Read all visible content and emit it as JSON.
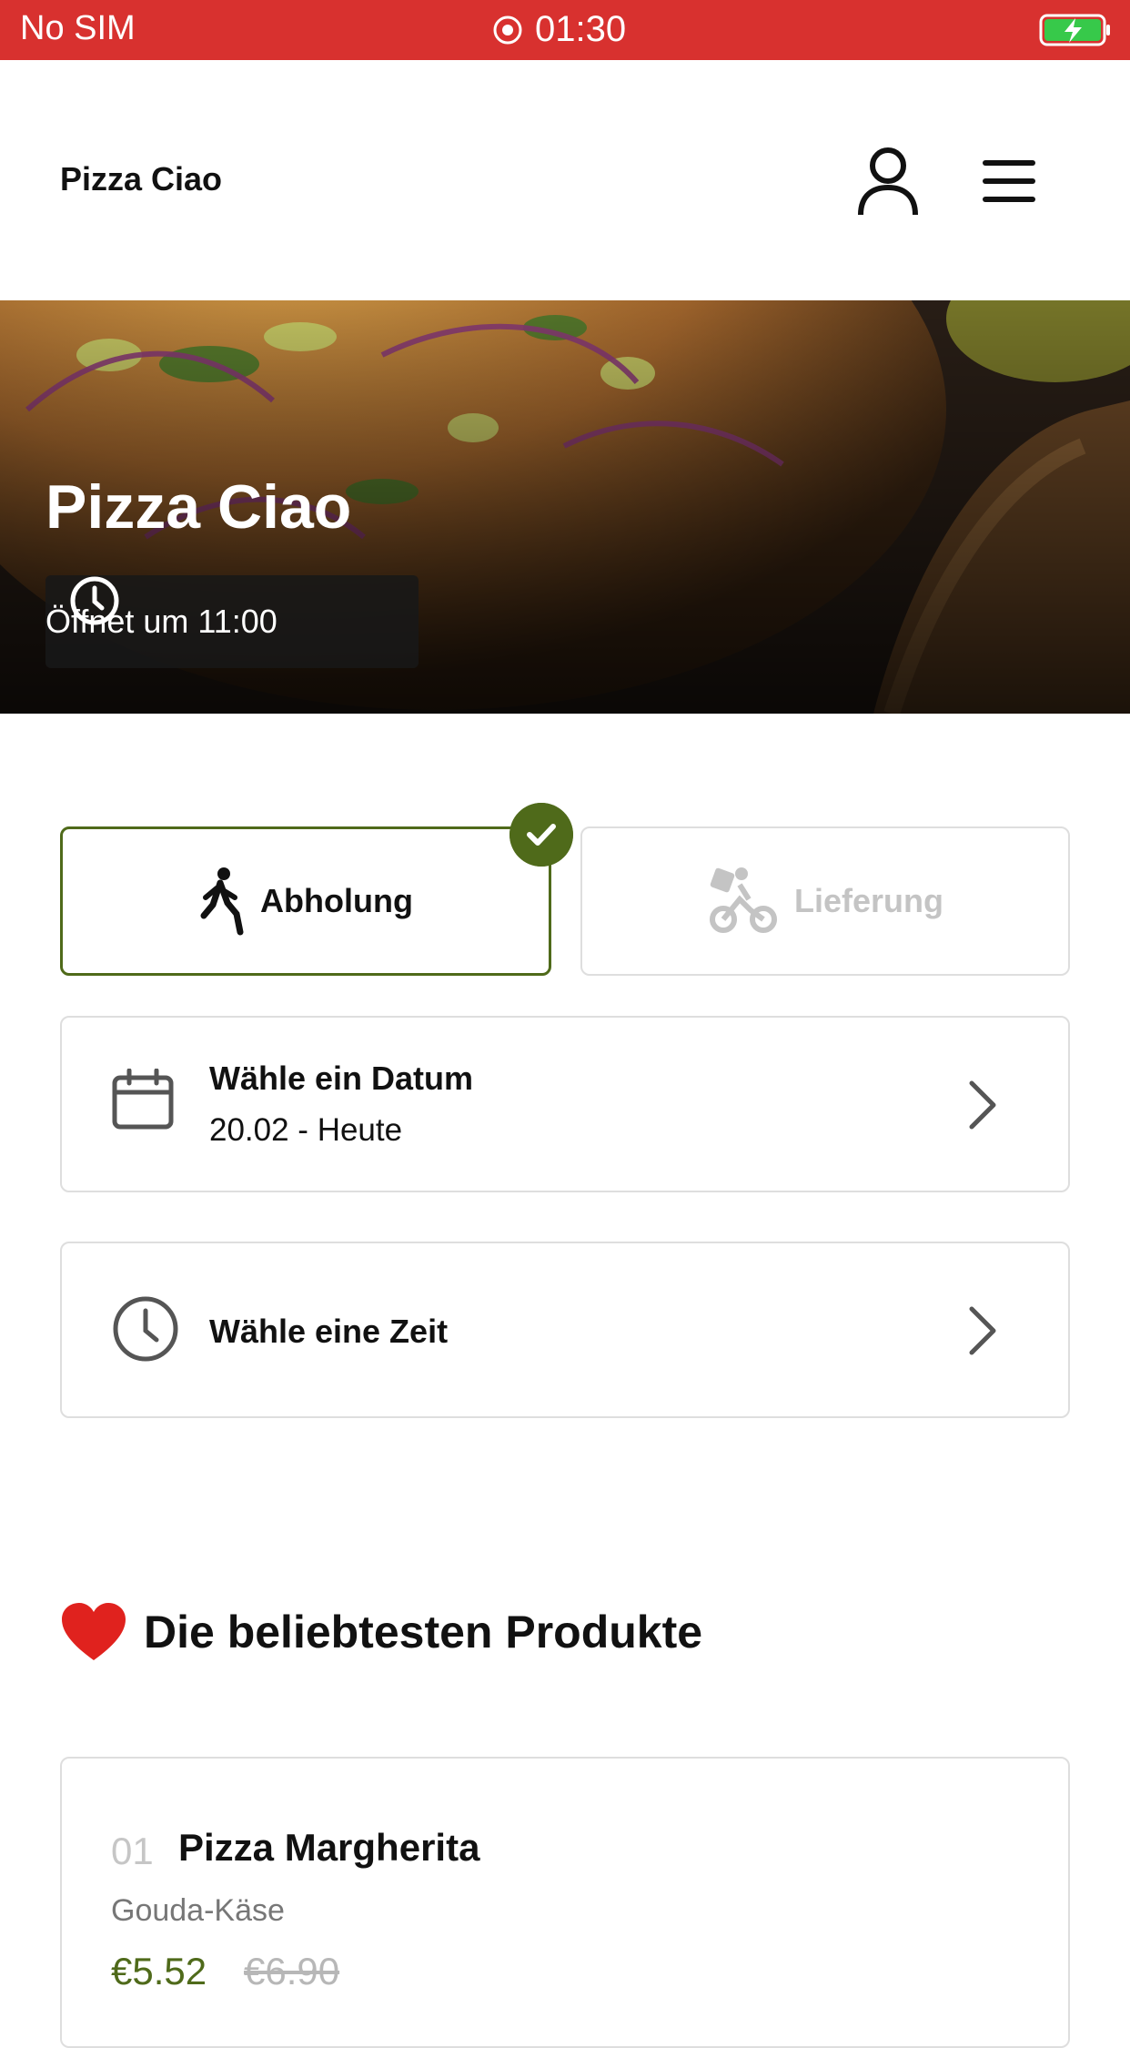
{
  "status_bar": {
    "carrier": "No SIM",
    "time": "01:30",
    "battery_icon": "battery-charging-icon"
  },
  "header": {
    "brand": "Pizza Ciao",
    "user_icon": "user-icon",
    "menu_icon": "hamburger-menu-icon"
  },
  "hero": {
    "title": "Pizza Ciao",
    "opening": "Öffnet um 11:00"
  },
  "order_mode": {
    "pickup_label": "Abholung",
    "delivery_label": "Lieferung",
    "selected": "Abholung",
    "accent": "#4f6a1a"
  },
  "date_picker": {
    "title": "Wähle ein Datum",
    "value": "20.02 - Heute"
  },
  "time_picker": {
    "title": "Wähle eine Zeit"
  },
  "popular": {
    "title": "Die beliebtesten Produkte",
    "items": [
      {
        "number": "01",
        "name": "Pizza Margherita",
        "description": "Gouda-Käse",
        "price": "€5.52",
        "old_price": "€6.90"
      }
    ]
  },
  "colors": {
    "brand_red": "#d8312f",
    "accent_green": "#4f6a1a"
  }
}
